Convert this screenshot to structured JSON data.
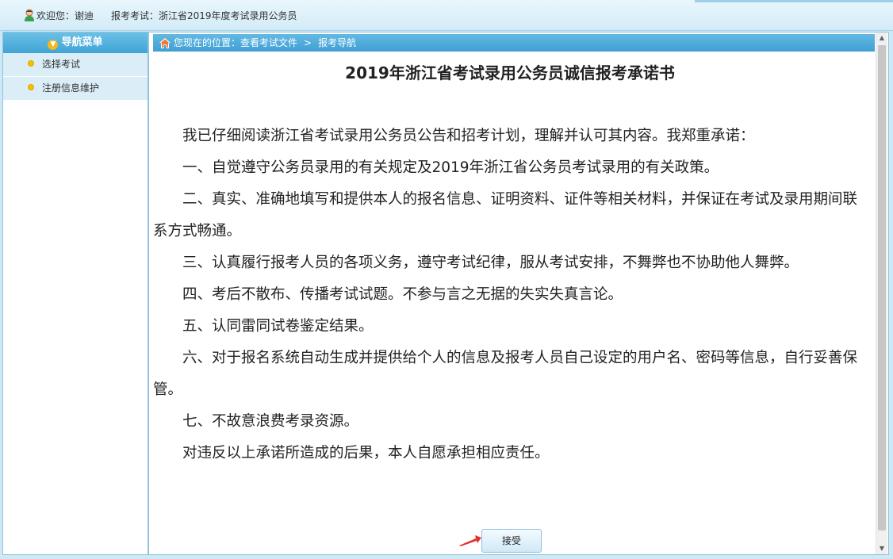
{
  "header": {
    "welcome_label": "欢迎您：谢迪",
    "exam_label": "报考考试：浙江省2019年度考试录用公务员"
  },
  "sidebar": {
    "title": "导航菜单",
    "items": [
      {
        "label": "选择考试"
      },
      {
        "label": "注册信息维护"
      }
    ]
  },
  "breadcrumb": {
    "prefix": "您现在的位置：查看考试文件",
    "separator": ">",
    "current": "报考导航"
  },
  "document": {
    "title": "2019年浙江省考试录用公务员诚信报考承诺书",
    "paragraphs": [
      "我已仔细阅读浙江省考试录用公务员公告和招考计划，理解并认可其内容。我郑重承诺：",
      "一、自觉遵守公务员录用的有关规定及2019年浙江省公务员考试录用的有关政策。",
      "二、真实、准确地填写和提供本人的报名信息、证明资料、证件等相关材料，并保证在考试及录用期间联系方式畅通。",
      "三、认真履行报考人员的各项义务，遵守考试纪律，服从考试安排，不舞弊也不协助他人舞弊。",
      "四、考后不散布、传播考试试题。不参与言之无据的失实失真言论。",
      "五、认同雷同试卷鉴定结果。",
      "六、对于报名系统自动生成并提供给个人的信息及报考人员自己设定的用户名、密码等信息，自行妥善保管。",
      "七、不故意浪费考录资源。",
      "对违反以上承诺所造成的后果，本人自愿承担相应责任。"
    ],
    "accept_label": "接受"
  },
  "colors": {
    "nav_blue": "#3fa4d6",
    "sidebar_item_bg": "#dbeef8",
    "arrow_red": "#e53030"
  }
}
